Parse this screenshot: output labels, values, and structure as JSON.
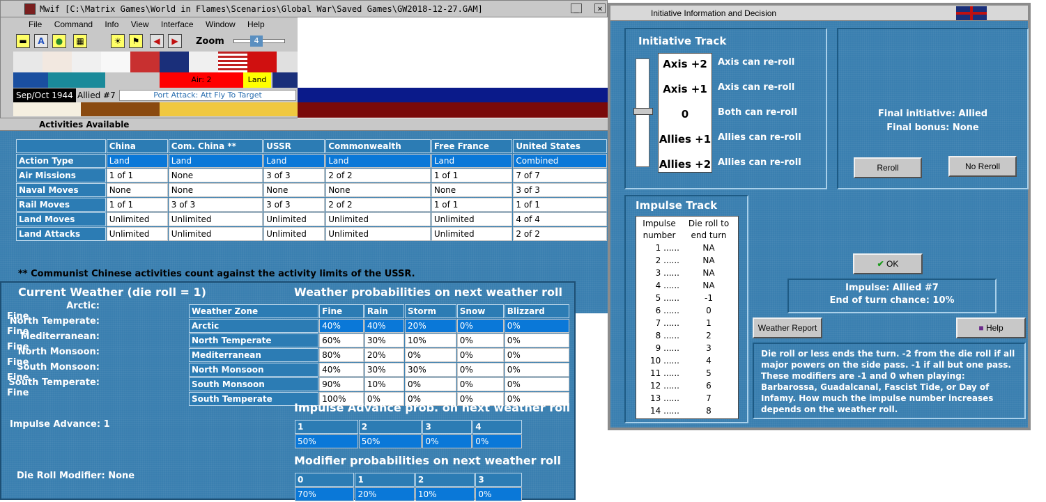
{
  "main_window": {
    "title": "Mwif [C:\\Matrix Games\\World in Flames\\Scenarios\\Global War\\Saved Games\\GW2018-12-27.GAM]",
    "menu": [
      "File",
      "Command",
      "Info",
      "View",
      "Interface",
      "Window",
      "Help"
    ],
    "toolbar_icons": [
      "train-icon",
      "text-a-icon",
      "settings-icon",
      "map-icon",
      "sun-icon",
      "flag-icon",
      "arrow-left-icon",
      "arrow-right-icon"
    ],
    "zoom_label": "Zoom",
    "zoom_value": "4",
    "air_label": "Air: 2",
    "land_label": "Land",
    "date": "Sep/Oct 1944",
    "impulse": "Allied #7",
    "phase": "Port Attack: Att Fly To Target"
  },
  "activities": {
    "title": "Activities Available",
    "columns": [
      "",
      "China",
      "Com. China **",
      "USSR",
      "Commonwealth",
      "Free France",
      "United States"
    ],
    "rows": [
      [
        "Action Type",
        "Land",
        "Land",
        "Land",
        "Land",
        "Land",
        "Combined"
      ],
      [
        "Air Missions",
        "1 of 1",
        "None",
        "3 of 3",
        "2 of 2",
        "1 of 1",
        "7 of 7"
      ],
      [
        "Naval Moves",
        "None",
        "None",
        "None",
        "None",
        "None",
        "3 of 3"
      ],
      [
        "Rail Moves",
        "1 of 1",
        "3 of 3",
        "3 of 3",
        "2 of 2",
        "1 of 1",
        "1 of 1"
      ],
      [
        "Land Moves",
        "Unlimited",
        "Unlimited",
        "Unlimited",
        "Unlimited",
        "Unlimited",
        "4 of 4"
      ],
      [
        "Land Attacks",
        "Unlimited",
        "Unlimited",
        "Unlimited",
        "Unlimited",
        "Unlimited",
        "2 of 2"
      ]
    ],
    "footnote": "** Communist Chinese activities count against the activity limits of the USSR."
  },
  "weather": {
    "title": "Current Weather (die roll = 1)",
    "current": [
      {
        "label": "Arctic:",
        "value": "Fine"
      },
      {
        "label": "North Temperate:",
        "value": "Fine"
      },
      {
        "label": "Mediterranean:",
        "value": "Fine"
      },
      {
        "label": "North Monsoon:",
        "value": "Fine"
      },
      {
        "label": "South Monsoon:",
        "value": "Fine"
      },
      {
        "label": "South Temperate:",
        "value": "Fine"
      }
    ],
    "prob_title": "Weather probabilities on next weather roll",
    "prob_columns": [
      "Weather Zone",
      "Fine",
      "Rain",
      "Storm",
      "Snow",
      "Blizzard"
    ],
    "prob_rows": [
      [
        "Arctic",
        "40%",
        "40%",
        "20%",
        "0%",
        "0%"
      ],
      [
        "North Temperate",
        "60%",
        "30%",
        "10%",
        "0%",
        "0%"
      ],
      [
        "Mediterranean",
        "80%",
        "20%",
        "0%",
        "0%",
        "0%"
      ],
      [
        "North Monsoon",
        "40%",
        "30%",
        "30%",
        "0%",
        "0%"
      ],
      [
        "South Monsoon",
        "90%",
        "10%",
        "0%",
        "0%",
        "0%"
      ],
      [
        "South Temperate",
        "100%",
        "0%",
        "0%",
        "0%",
        "0%"
      ]
    ],
    "impulse_advance_label": "Impulse Advance:",
    "impulse_advance_value": "1",
    "impulse_title": "Impulse Advance prob. on next weather roll",
    "impulse_cols": [
      "1",
      "2",
      "3",
      "4"
    ],
    "impulse_vals": [
      "50%",
      "50%",
      "0%",
      "0%"
    ],
    "modifier_label": "Die Roll Modifier:",
    "modifier_value": "None",
    "modifier_title": "Modifier probabilities on next weather roll",
    "modifier_cols": [
      "0",
      "1",
      "2",
      "3"
    ],
    "modifier_vals": [
      "70%",
      "20%",
      "10%",
      "0%"
    ]
  },
  "initiative": {
    "window_title": "Initiative Information and Decision",
    "track_title": "Initiative Track",
    "track": [
      {
        "label": "Axis +2",
        "desc": "Axis can re-roll"
      },
      {
        "label": "Axis +1",
        "desc": "Axis can re-roll"
      },
      {
        "label": "0",
        "desc": "Both can re-roll"
      },
      {
        "label": "Allies +1",
        "desc": "Allies can re-roll"
      },
      {
        "label": "Allies +2",
        "desc": "Allies can re-roll"
      }
    ],
    "final_initiative": "Final initiative: Allied",
    "final_bonus": "Final bonus: None",
    "reroll": "Reroll",
    "no_reroll": "No Reroll",
    "impulse_title": "Impulse Track",
    "impulse_head1": "Impulse number",
    "impulse_head2": "Die roll to end turn",
    "impulse_rows": [
      [
        "1 ......",
        "NA"
      ],
      [
        "2 ......",
        "NA"
      ],
      [
        "3 ......",
        "NA"
      ],
      [
        "4 ......",
        "NA"
      ],
      [
        "5 ......",
        "-1"
      ],
      [
        "6 ......",
        "0"
      ],
      [
        "7 ......",
        "1"
      ],
      [
        "8 ......",
        "2"
      ],
      [
        "9 ......",
        "3"
      ],
      [
        "10 ......",
        "4"
      ],
      [
        "11 ......",
        "5"
      ],
      [
        "12 ......",
        "6"
      ],
      [
        "13 ......",
        "7"
      ],
      [
        "14 ......",
        "8"
      ]
    ],
    "ok": "OK",
    "impulse_status": "Impulse: Allied #7",
    "end_chance": "End of turn chance: 10%",
    "weather_report": "Weather Report",
    "help": "Help",
    "note": "Die roll or less ends the turn.  -2 from the die roll if all major powers on the side pass.  -1 if all but one pass.  These modifiers are -1 and 0 when playing: Barbarossa, Guadalcanal, Fascist Tide, or Day of Infamy.  How much the impulse number increases depends on the weather roll."
  }
}
